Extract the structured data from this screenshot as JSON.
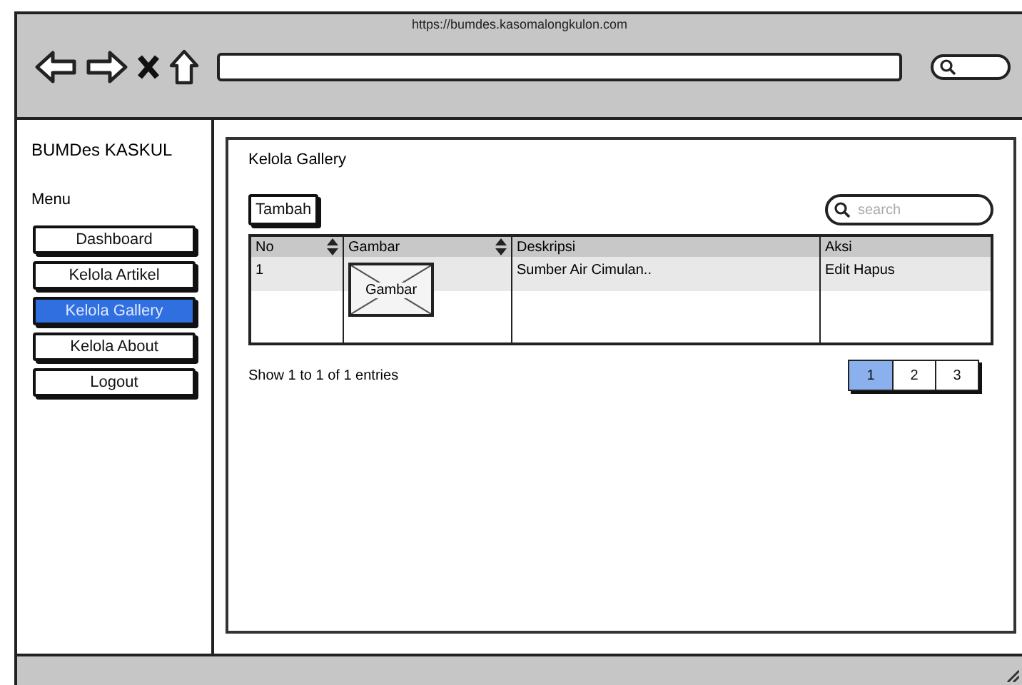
{
  "browser": {
    "url_title": "https://bumdes.kasomalongkulon.com"
  },
  "sidebar": {
    "brand": "BUMDes KASKUL",
    "menu_label": "Menu",
    "items": [
      {
        "label": "Dashboard",
        "selected": false
      },
      {
        "label": "Kelola Artikel",
        "selected": false
      },
      {
        "label": "Kelola Gallery",
        "selected": true
      },
      {
        "label": "Kelola About",
        "selected": false
      },
      {
        "label": "Logout",
        "selected": false
      }
    ]
  },
  "content": {
    "title": "Kelola Gallery",
    "add_button": "Tambah",
    "search": {
      "placeholder": "search"
    },
    "table": {
      "columns": [
        {
          "label": "No",
          "sortable": true
        },
        {
          "label": "Gambar",
          "sortable": true
        },
        {
          "label": "Deskripsi",
          "sortable": false
        },
        {
          "label": "Aksi",
          "sortable": false
        }
      ],
      "rows": [
        {
          "no": "1",
          "image_label": "Gambar",
          "description": "Sumber Air Cimulan..",
          "actions": "Edit Hapus"
        }
      ]
    },
    "entries": "Show 1 to 1 of 1 entries",
    "pages": [
      {
        "label": "1",
        "selected": true
      },
      {
        "label": "2",
        "selected": false
      },
      {
        "label": "3",
        "selected": false
      }
    ]
  }
}
